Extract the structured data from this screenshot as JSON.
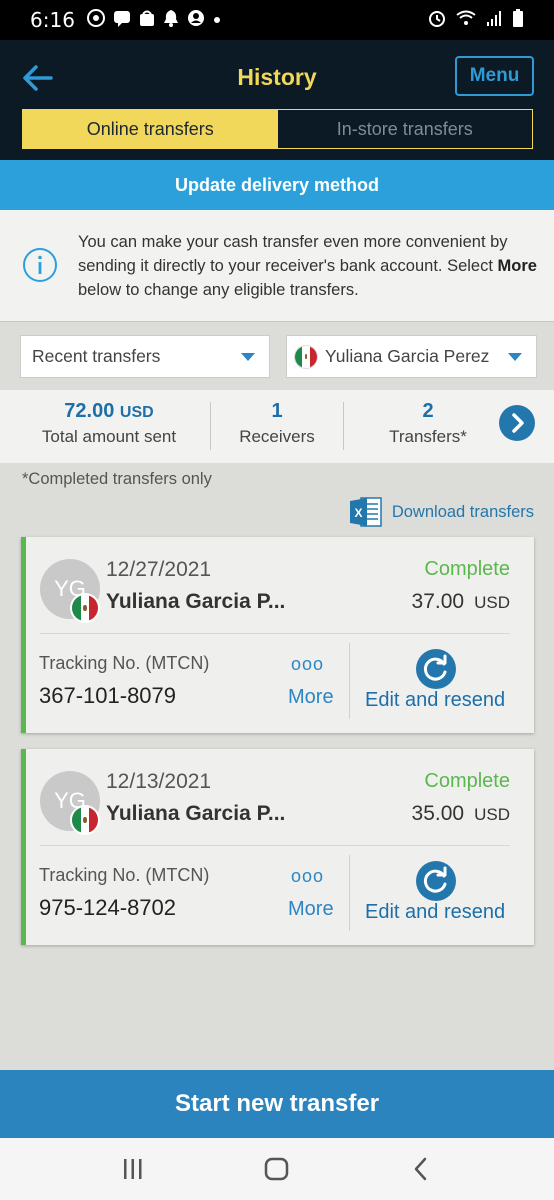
{
  "status_bar": {
    "time": "6:16"
  },
  "header": {
    "title": "History",
    "menu_label": "Menu",
    "tabs": [
      {
        "label": "Online transfers",
        "active": true
      },
      {
        "label": "In-store transfers",
        "active": false
      }
    ]
  },
  "banner": {
    "label": "Update delivery method"
  },
  "info": {
    "text_before": "You can make your cash transfer even more convenient by sending it directly to your receiver's bank account. Select ",
    "text_bold": "More",
    "text_after": " below to change any eligible transfers."
  },
  "filters": {
    "period": "Recent transfers",
    "receiver": "Yuliana Garcia Perez"
  },
  "summary": {
    "total_amount": "72.00",
    "total_currency": "USD",
    "total_label": "Total amount sent",
    "receivers_count": "1",
    "receivers_label": "Receivers",
    "transfers_count": "2",
    "transfers_label": "Transfers*"
  },
  "footnote": "*Completed transfers only",
  "download_label": "Download transfers",
  "transfers": [
    {
      "initials": "YG",
      "date": "12/27/2021",
      "name": "Yuliana Garcia P...",
      "status": "Complete",
      "amount": "37.00",
      "currency": "USD",
      "tracking_label": "Tracking No. (MTCN)",
      "tracking_no": "367-101-8079",
      "more_dots": "ooo",
      "more_label": "More",
      "resend_label": "Edit and resend"
    },
    {
      "initials": "YG",
      "date": "12/13/2021",
      "name": "Yuliana Garcia P...",
      "status": "Complete",
      "amount": "35.00",
      "currency": "USD",
      "tracking_label": "Tracking No. (MTCN)",
      "tracking_no": "975-124-8702",
      "more_dots": "ooo",
      "more_label": "More",
      "resend_label": "Edit and resend"
    }
  ],
  "start_button": "Start new transfer",
  "colors": {
    "accent_yellow": "#f1d85b",
    "accent_blue": "#2c86c4",
    "status_green": "#5ab84e",
    "header_bg": "#0b1a24"
  }
}
